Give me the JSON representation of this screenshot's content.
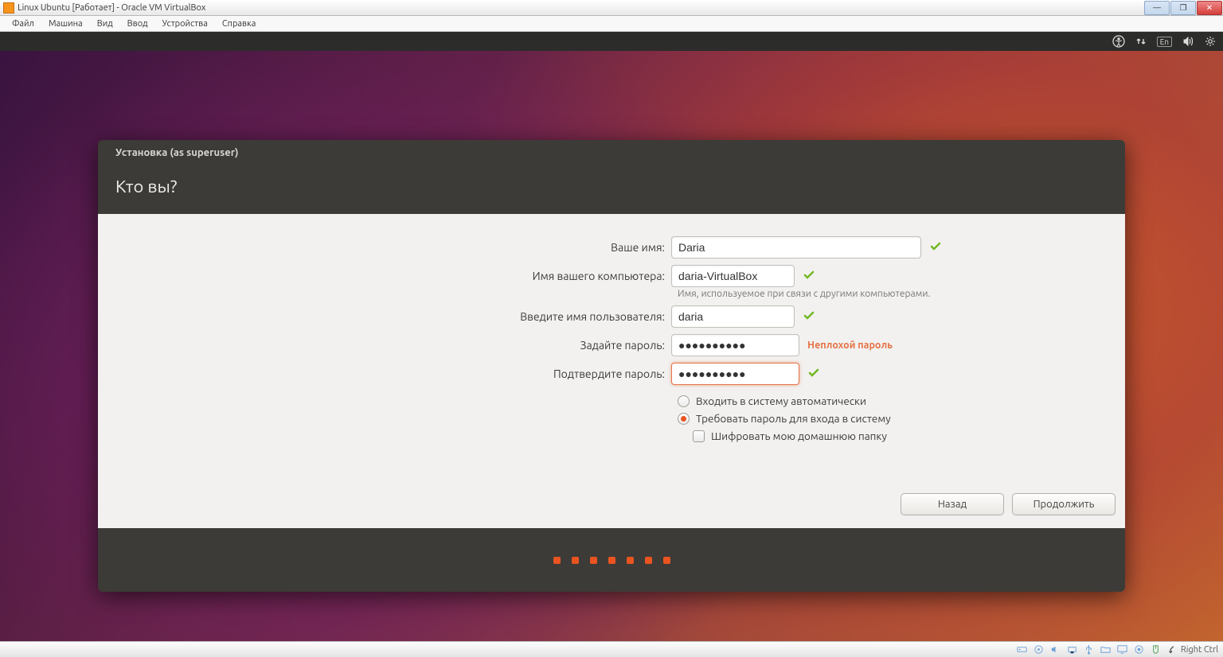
{
  "window": {
    "title": "Linux Ubuntu [Работает] - Oracle VM VirtualBox"
  },
  "vb_menu": {
    "file": "Файл",
    "machine": "Машина",
    "view": "Вид",
    "input": "Ввод",
    "devices": "Устройства",
    "help": "Справка"
  },
  "panel": {
    "lang": "En"
  },
  "installer": {
    "title": "Установка (as superuser)",
    "heading": "Кто вы?",
    "name_label": "Ваше имя:",
    "name_value": "Daria",
    "computer_label": "Имя вашего компьютера:",
    "computer_value": "daria-VirtualBox",
    "computer_hint": "Имя, используемое при связи с другими компьютерами.",
    "user_label": "Введите имя пользователя:",
    "user_value": "daria",
    "pw_label": "Задайте пароль:",
    "pw_value": "●●●●●●●●●●",
    "pw_hint": "Неплохой пароль",
    "pw2_label": "Подтвердите пароль:",
    "pw2_value": "●●●●●●●●●●",
    "radio_auto": "Входить в систему автоматически",
    "radio_pw": "Требовать пароль для входа в систему",
    "check_encrypt": "Шифровать мою домашнюю папку",
    "back": "Назад",
    "continue": "Продолжить"
  },
  "vb_status": {
    "host_key": "Right Ctrl"
  }
}
